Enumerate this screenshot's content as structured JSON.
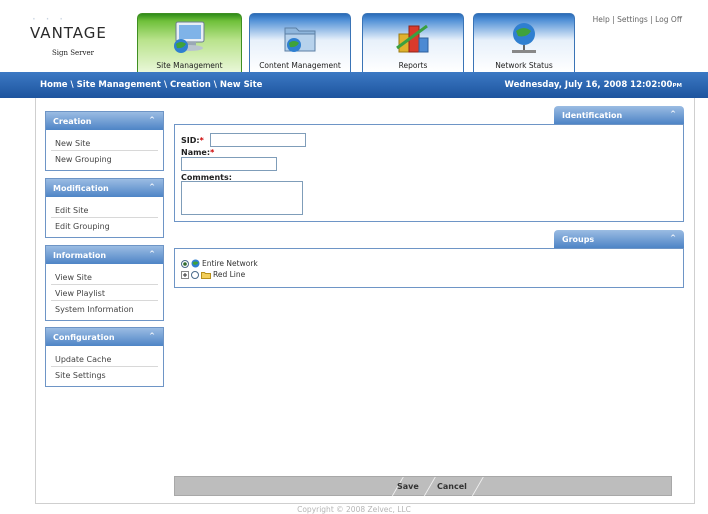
{
  "header": {
    "logo_text": "VANTAGE",
    "logo_sub": "Sign Server",
    "top_links": [
      "Help",
      "Settings",
      "Log Off"
    ],
    "tabs": [
      {
        "label": "Site Management",
        "icon": "computer-globe-icon",
        "active": true
      },
      {
        "label": "Content Management",
        "icon": "folder-globe-icon",
        "active": false
      },
      {
        "label": "Reports",
        "icon": "bar-chart-icon",
        "active": false
      },
      {
        "label": "Network Status",
        "icon": "network-globe-icon",
        "active": false
      }
    ]
  },
  "navbar": {
    "breadcrumb": [
      "Home",
      "Site Management",
      "Creation",
      "New Site"
    ],
    "datetime": "Wednesday, July 16, 2008 12:02:00",
    "ampm": "PM"
  },
  "sidebar": {
    "sections": [
      {
        "title": "Creation",
        "items": [
          "New Site",
          "New Grouping"
        ]
      },
      {
        "title": "Modification",
        "items": [
          "Edit Site",
          "Edit Grouping"
        ]
      },
      {
        "title": "Information",
        "items": [
          "View Site",
          "View Playlist",
          "System Information"
        ]
      },
      {
        "title": "Configuration",
        "items": [
          "Update Cache",
          "Site Settings"
        ]
      }
    ]
  },
  "identification": {
    "title": "Identification",
    "sid_label": "SID:",
    "name_label": "Name:",
    "comments_label": "Comments:",
    "required_mark": "*",
    "sid_value": "",
    "name_value": "",
    "comments_value": ""
  },
  "groups": {
    "title": "Groups",
    "items": [
      {
        "label": "Entire Network",
        "selected": true
      },
      {
        "label": "Red Line",
        "selected": false
      }
    ]
  },
  "actions": {
    "save": "Save",
    "cancel": "Cancel"
  },
  "footer": {
    "copyright": "Copyright © 2008 Zelvec, LLC"
  },
  "colors": {
    "nav_blue": "#1d549e",
    "panel_head": "#4e84c6",
    "active_tab": "#6fc03a",
    "required": "#cc0000"
  }
}
